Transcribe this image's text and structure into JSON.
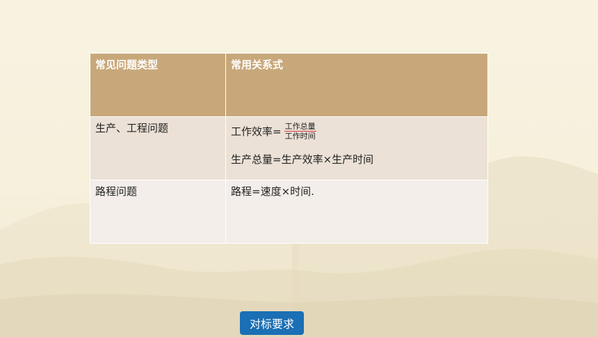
{
  "table": {
    "headers": [
      "常见问题类型",
      "常用关系式"
    ],
    "rows": [
      {
        "type": "生产、工程问题",
        "formula1_prefix": "工作效率=",
        "formula1_numerator": "工作总量",
        "formula1_denominator": "工作时间",
        "formula2": "生产总量=生产效率×生产时间"
      },
      {
        "type": "路程问题",
        "formula1": "路程=速度×时间."
      }
    ]
  },
  "button": {
    "label": "对标要求"
  },
  "colors": {
    "header_bg": "#c8a87a",
    "row1_bg": "#ebe1d6",
    "row2_bg": "#f3eee9",
    "button_bg": "#1a6fb5",
    "fraction_line": "#d9363e"
  }
}
